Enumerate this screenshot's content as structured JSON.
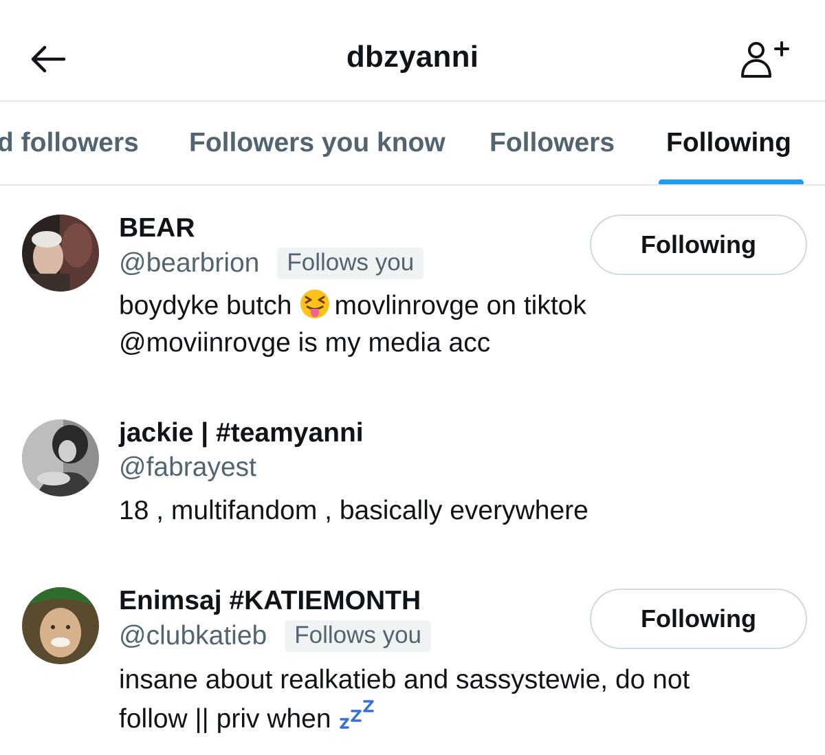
{
  "header": {
    "title": "dbzyanni",
    "back_icon": "arrow-left-icon",
    "add_icon": "add-user-icon"
  },
  "tabs": [
    {
      "label": "d followers",
      "active": false
    },
    {
      "label": "Followers you know",
      "active": false
    },
    {
      "label": "Followers",
      "active": false
    },
    {
      "label": "Following",
      "active": true
    }
  ],
  "users": [
    {
      "name": "BEAR",
      "handle": "@bearbrion",
      "follows_you": "Follows you",
      "bio_line1_a": "boydyke butch",
      "bio_line1_b": "movlinrovge on tiktok",
      "bio_line2": "@moviinrovge is my media acc",
      "button": "Following"
    },
    {
      "name": "jackie | #teamyanni",
      "handle": "@fabrayest",
      "bio_line1": "18 , multifandom , basically everywhere"
    },
    {
      "name": "Enimsaj #KATIEMONTH",
      "handle": "@clubkatieb",
      "follows_you": "Follows you",
      "bio_line1": "insane about realkatieb and sassystewie, do not",
      "bio_line2": "follow || priv when",
      "button": "Following"
    }
  ],
  "colors": {
    "accent": "#1d9bf0",
    "text_primary": "#0f1419",
    "text_secondary": "#536471",
    "divider": "#e6e9ec"
  }
}
